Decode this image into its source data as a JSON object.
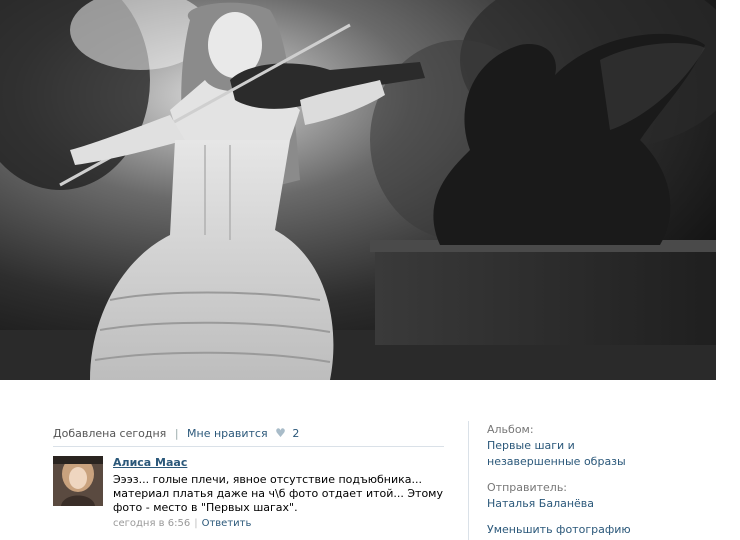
{
  "photo": {
    "description_icon": "photo-of-girl-with-violin-and-griffin-statue"
  },
  "meta": {
    "added": "Добавлена сегодня",
    "like_label": "Мне нравится",
    "heart_icon": "heart-icon",
    "like_count": "2"
  },
  "comment": {
    "author": "Алиса Маас",
    "text": "Эээз... голые плечи, явное отсутствие подъюбника... материал платья даже на ч\\б фото отдает итой... Этому фото - место в \"Первых шагах\".",
    "time": "сегодня в 6:56",
    "reply": "Ответить"
  },
  "sidebar": {
    "album_label": "Альбом:",
    "album_name": "Первые шаги и незавершенные образы",
    "sender_label": "Отправитель:",
    "sender_name": "Наталья Баланёва",
    "shrink": "Уменьшить фотографию"
  },
  "colors": {
    "link": "#2b587a",
    "divider": "#dae1e8",
    "muted": "#555555"
  }
}
